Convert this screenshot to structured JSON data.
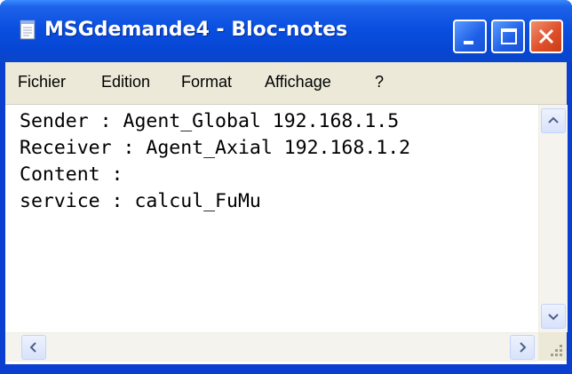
{
  "window": {
    "title": "MSGdemande4 - Bloc-notes",
    "accent_color": "#0a46d8",
    "icons": {
      "app": "notepad-icon",
      "minimize": "minimize-icon",
      "maximize": "maximize-icon",
      "close": "close-icon"
    }
  },
  "menu": {
    "items": [
      {
        "label": "Fichier"
      },
      {
        "label": "Edition"
      },
      {
        "label": "Format"
      },
      {
        "label": "Affichage"
      },
      {
        "label": "?"
      }
    ]
  },
  "editor": {
    "content": "Sender : Agent_Global 192.168.1.5\nReceiver : Agent_Axial 192.168.1.2\nContent :\nservice : calcul_FuMu"
  },
  "scrollbars": {
    "icons": {
      "up": "chevron-up-icon",
      "down": "chevron-down-icon",
      "left": "chevron-left-icon",
      "right": "chevron-right-icon",
      "grip": "resize-grip-icon"
    }
  }
}
